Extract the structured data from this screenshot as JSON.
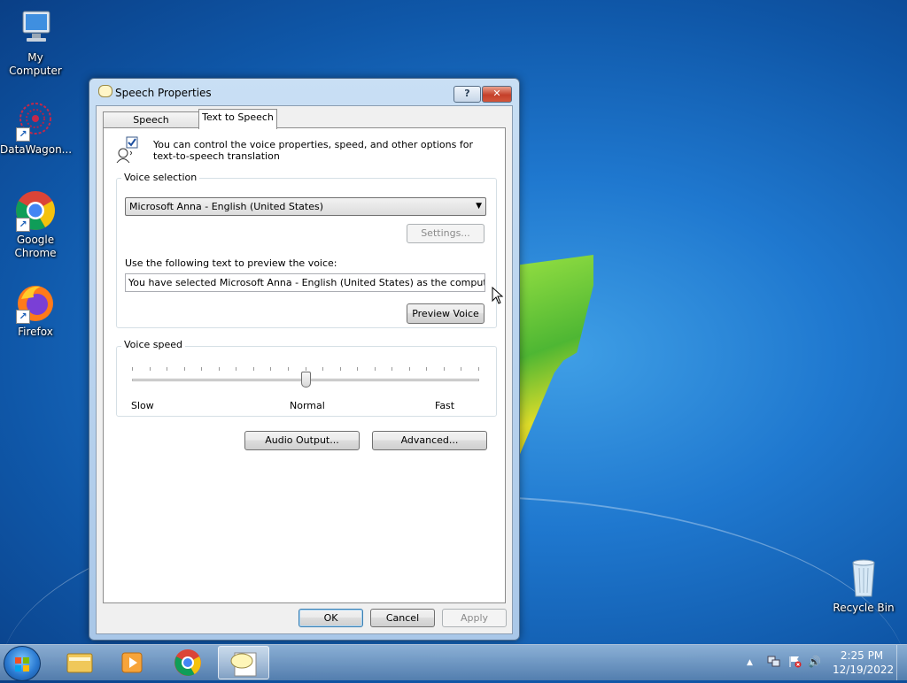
{
  "desktop": {
    "icons": [
      {
        "label": "My Computer",
        "icon": "computer-icon"
      },
      {
        "label": "DataWagon...",
        "icon": "datawagon-icon"
      },
      {
        "label": "Google Chrome",
        "icon": "chrome-icon"
      },
      {
        "label": "Firefox",
        "icon": "firefox-icon"
      },
      {
        "label": "Recycle Bin",
        "icon": "recycle-bin-icon"
      }
    ]
  },
  "window": {
    "title": "Speech Properties",
    "help_btn": "?",
    "close_btn": "✕",
    "tabs": [
      {
        "label": "Speech Recognition",
        "active": false
      },
      {
        "label": "Text to Speech",
        "active": true
      }
    ],
    "intro_line1": "You can control the voice properties, speed, and other options for",
    "intro_line2": "text-to-speech translation",
    "voice_selection": {
      "label": "Voice selection",
      "selected_voice": "Microsoft Anna - English (United States)",
      "settings_btn": "Settings...",
      "preview_label": "Use the following text to preview the voice:",
      "preview_text": "You have selected Microsoft Anna - English (United States) as the computer's default",
      "preview_btn": "Preview Voice"
    },
    "voice_speed": {
      "label": "Voice speed",
      "slow": "Slow",
      "normal": "Normal",
      "fast": "Fast",
      "value_fraction": 0.5
    },
    "audio_output_btn": "Audio Output...",
    "advanced_btn": "Advanced...",
    "ok_btn": "OK",
    "cancel_btn": "Cancel",
    "apply_btn": "Apply"
  },
  "taskbar": {
    "apps": [
      "explorer-icon",
      "media-player-icon",
      "chrome-icon",
      "speech-icon"
    ],
    "time": "2:25 PM",
    "date": "12/19/2022",
    "tray_arrow": "▲",
    "volume_glyph": "🔊"
  },
  "colors": {
    "accent": "#1f78cf",
    "close_red": "#c5402a",
    "default_button_border": "#3c7fb1"
  }
}
